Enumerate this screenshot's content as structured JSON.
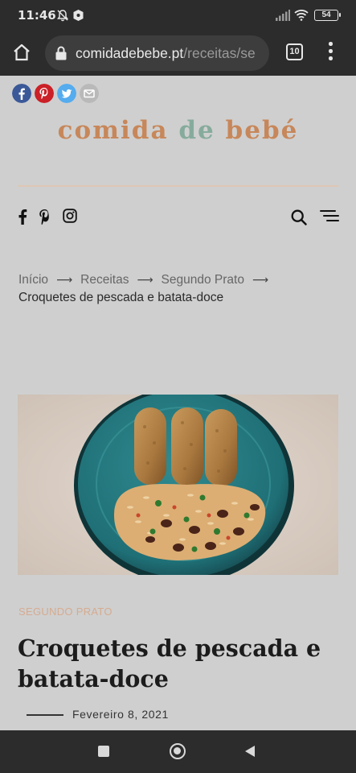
{
  "status_bar": {
    "time": "11:46",
    "battery": "54",
    "icons": [
      "mute-bell-icon",
      "vpn-shield-icon",
      "signal-icon",
      "wifi-icon",
      "battery-icon"
    ]
  },
  "browser": {
    "url_host": "comidadebebe.pt",
    "url_path": "/receitas/se",
    "tab_count": "10",
    "icons": [
      "home-icon",
      "lock-icon",
      "tabs-icon",
      "more-menu-icon"
    ]
  },
  "share": {
    "buttons": [
      "facebook-share-icon",
      "pinterest-share-icon",
      "twitter-share-icon",
      "email-share-icon"
    ],
    "colors": {
      "facebook": "#3b5998",
      "pinterest": "#cb2027",
      "twitter": "#55acee",
      "email": "#b9b9b9"
    }
  },
  "site": {
    "logo_part1": "comida",
    "logo_part2": "de",
    "logo_part3": "bebé",
    "social_icons": [
      "facebook-icon",
      "pinterest-icon",
      "instagram-icon"
    ]
  },
  "breadcrumb": {
    "items": [
      "Início",
      "Receitas",
      "Segundo Prato"
    ],
    "separator": "⟶",
    "current": "Croquetes de pescada e batata-doce"
  },
  "article": {
    "category": "Segundo Prato",
    "title": "Croquetes de pescada e batata-doce",
    "date": "Fevereiro 8, 2021"
  },
  "colors": {
    "logo_brown": "#c7875a",
    "logo_green": "#86ab9c",
    "category": "#d6ab90",
    "page_bg": "#cfcfcf",
    "chrome": "#2c2c2c"
  }
}
